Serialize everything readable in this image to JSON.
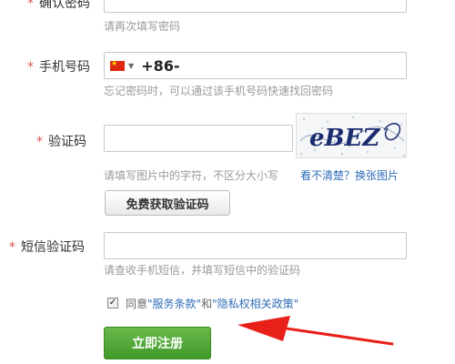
{
  "confirm_password": {
    "label": "确认密码",
    "required_mark": "*",
    "hint": "请再次填写密码",
    "value": ""
  },
  "phone": {
    "label": "手机号码",
    "required_mark": "*",
    "country_code": "+86-",
    "flag_icon": "china-flag-icon",
    "hint": "忘记密码时，可以通过该手机号码快速找回密码",
    "value": ""
  },
  "captcha": {
    "label": "验证码",
    "required_mark": "*",
    "hint": "请填写图片中的字符，不区分大小写",
    "refresh_link": "看不清楚？换张图片",
    "image_text": "eBEZ",
    "get_code_button": "免费获取验证码",
    "value": ""
  },
  "sms_code": {
    "label": "短信验证码",
    "required_mark": "*",
    "hint": "请查收手机短信，并填写短信中的验证码",
    "value": ""
  },
  "agreement": {
    "checked": true,
    "prefix": "同意",
    "terms_link": "\"服务条款\"",
    "and": "和",
    "privacy_link": "\"隐私权相关政策\""
  },
  "submit_button": "立即注册",
  "colors": {
    "required": "#d9534f",
    "link": "#2f6db5",
    "submit_green": "#4ea634",
    "arrow_red": "#e8201a"
  }
}
